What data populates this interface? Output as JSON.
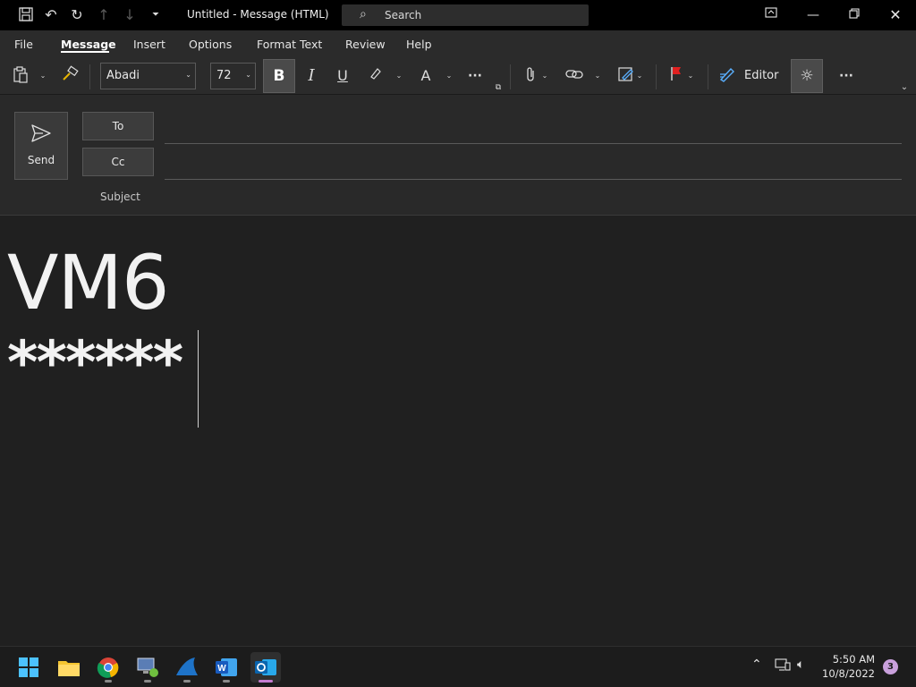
{
  "titlebar": {
    "title": "Untitled  -  Message (HTML)",
    "search_label": "Search",
    "icons": [
      "save-icon",
      "undo-icon",
      "redo-icon",
      "up-arrow-icon",
      "down-arrow-icon",
      "customize-icon"
    ],
    "window_controls": [
      "restore-ribbon-icon",
      "minimize-icon",
      "maximize-icon",
      "close-icon"
    ]
  },
  "menu": {
    "tabs": [
      "File",
      "Message",
      "Insert",
      "Options",
      "Format Text",
      "Review",
      "Help"
    ],
    "active_tab": "Message"
  },
  "ribbon": {
    "font_name": "Abadi",
    "font_size": "72",
    "bold_label": "B",
    "italic_label": "I",
    "underline_label": "U",
    "font_color_label": "A",
    "more_label": "···",
    "editor_label": "Editor",
    "highlight_color": "#ffee00",
    "font_color": "#e01b1b",
    "flag_color": "#e02020"
  },
  "compose": {
    "send_label": "Send",
    "to_label": "To",
    "cc_label": "Cc",
    "subject_label": "Subject",
    "to_value": "",
    "cc_value": "",
    "subject_value": ""
  },
  "body": {
    "line1": "VM6",
    "line2": "******"
  },
  "taskbar": {
    "apps": [
      "start",
      "file-explorer",
      "chrome",
      "remote-desktop",
      "shark",
      "word",
      "outlook"
    ],
    "active_app": "outlook",
    "time": "5:50 AM",
    "date": "10/8/2022",
    "notification_count": "3"
  }
}
